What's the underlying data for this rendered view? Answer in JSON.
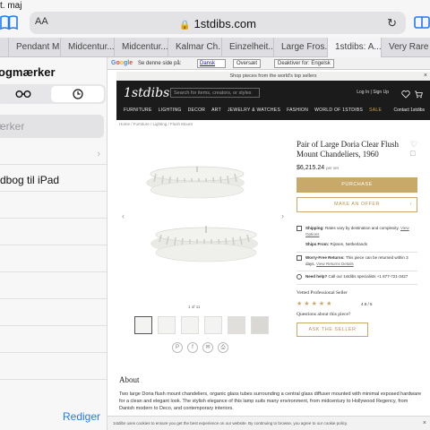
{
  "status": {
    "time": "t. maj"
  },
  "browser": {
    "aa_label": "AA",
    "url": "1stdibs.com",
    "tabs": [
      "Pendant M...",
      "Midcentur...",
      "Midcentur...",
      "Kalmar Ch...",
      "Einzelheit...",
      "Large Fros...",
      "1stdibs: A...",
      "Very Rare"
    ],
    "tab_counts": [
      ""
    ]
  },
  "sidebar": {
    "title": "ogmærker",
    "search_placeholder": "ærker",
    "rows": [
      {
        "label": ""
      },
      {
        "label": "dbog til iPad"
      }
    ],
    "edit_label": "Rediger"
  },
  "translate_bar": {
    "logo": "Google",
    "prompt": "Se denne side på:",
    "language": "Dansk",
    "translate_btn": "Oversæt",
    "disable_btn": "Deaktiver for: Engelsk"
  },
  "site": {
    "promo": "Shop pieces from the world's top sellers",
    "logo": "1stdibs",
    "search_placeholder": "Search for items, creators, or styles",
    "header_links": "Log In  |  Sign Up",
    "nav": [
      "FURNITURE",
      "LIGHTING",
      "DECOR",
      "ART",
      "JEWELRY & WATCHES",
      "FASHION",
      "WORLD OF 1STDIBS",
      "SALE"
    ],
    "nav_right": "Contact 1stdibs",
    "breadcrumbs": "Home  /  Furniture  /  Lighting  /  Flush Mount",
    "pager": "1 of 11",
    "product": {
      "title": "Pair of Large Doria Clear Flush Mount Chandeliers, 1960",
      "price": "$6,215.24",
      "price_note": "per set",
      "purchase": "PURCHASE",
      "offer": "MAKE AN OFFER",
      "shipping_bold": "Shipping:",
      "shipping": "Rates vary by destination and complexity.",
      "shipping_link": "View Options",
      "ships_from_bold": "Ships From:",
      "ships_from": "Rijssen, Netherlands",
      "returns_bold": "Worry-Free Returns:",
      "returns": "This piece can be returned within 3 days.",
      "returns_link": "View Returns Details",
      "help_bold": "Need help?",
      "help": "Call our 1stdibs specialists +1 877-721-3427",
      "vetted": "Vetted Professional Seller",
      "rating": "4.9 / 5",
      "questions": "Questions about this piece?",
      "ask_seller": "ASK THE SELLER"
    },
    "about_title": "About",
    "about_text": "Two large Doria flush mount chandeliers, organic glass tubes surrounding a central glass diffuser mounted with minimal exposed hardware for a clean and elegant look. The stylish elegance of this lamp suits many environment, from midcentury to Hollywood Regency, from Danish modern to Deco, and contemporary interiors.",
    "cookie": "1stdibs uses cookies to ensure you get the best experience on our website. By continuing to browse, you agree to our cookie policy."
  },
  "colors": {
    "accent": "#1e7cf2",
    "gold": "#c8a96a",
    "site_header": "#1b1b1b"
  }
}
